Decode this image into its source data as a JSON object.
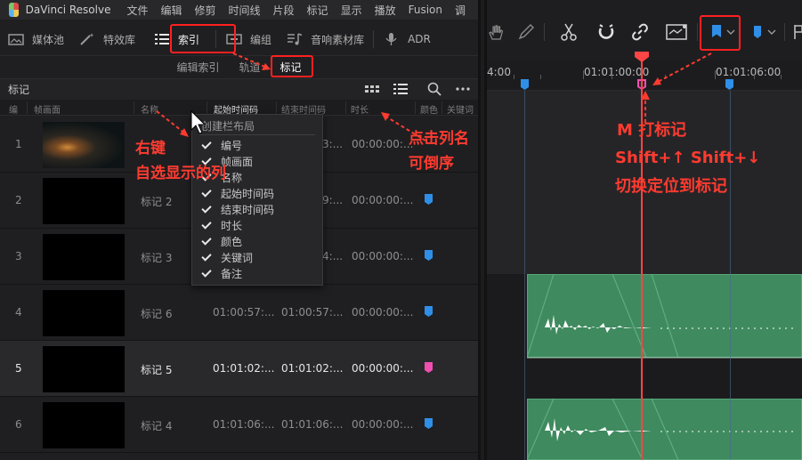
{
  "menubar": {
    "app": "DaVinci Resolve",
    "items": [
      "文件",
      "编辑",
      "修剪",
      "时间线",
      "片段",
      "标记",
      "显示",
      "播放",
      "Fusion",
      "调"
    ]
  },
  "toolbar": {
    "media_pool": "媒体池",
    "effects": "特效库",
    "index": "索引",
    "edit_group": "编组",
    "sound_library": "音响素材库",
    "adr": "ADR"
  },
  "subtabs": {
    "edit_index": "编辑索引",
    "tracks": "轨道",
    "markers": "标记"
  },
  "pane": {
    "title": "标记"
  },
  "columns": {
    "num": "编",
    "thumb": "帧画面",
    "name": "名称",
    "start": "起始时间码",
    "end": "结束时间码",
    "duration": "时长",
    "color": "颜色",
    "keyword": "关键词"
  },
  "rows": [
    {
      "num": "1",
      "name": "",
      "start": "",
      "end": "3:...",
      "duration": "00:00:00:...",
      "color": "",
      "thumb_style": "nebula"
    },
    {
      "num": "2",
      "name": "标记 2",
      "start": "",
      "end": "9:...",
      "duration": "00:00:00:...",
      "color": "#2f8fe8"
    },
    {
      "num": "3",
      "name": "标记 3",
      "start": "",
      "end": "4:...",
      "duration": "00:00:00:...",
      "color": "#2f8fe8"
    },
    {
      "num": "4",
      "name": "标记 6",
      "start": "01:00:57:...",
      "end": "01:00:57:...",
      "duration": "00:00:00:...",
      "color": "#2f8fe8"
    },
    {
      "num": "5",
      "name": "标记 5",
      "start": "01:01:02:...",
      "end": "01:01:02:...",
      "duration": "00:00:00:...",
      "color": "#f04fb0",
      "selected": true
    },
    {
      "num": "6",
      "name": "标记 4",
      "start": "01:01:06:...",
      "end": "01:01:06:...",
      "duration": "00:00:00:...",
      "color": "#2f8fe8"
    }
  ],
  "context_menu": {
    "title": "创建栏布局",
    "items": [
      "编号",
      "帧画面",
      "名称",
      "起始时间码",
      "结束时间码",
      "时长",
      "颜色",
      "关键词",
      "备注"
    ]
  },
  "annotations": {
    "right_click": "右键",
    "choose_columns": "自选显示的列",
    "click_column": "点击列名",
    "reverse_sort": "可倒序",
    "m_marker": "M 打标记",
    "shift_keys": "Shift+↑ Shift+↓",
    "jump_marker": "切换定位到标记"
  },
  "timeline": {
    "tc1": "4:00",
    "tc2": "01:01:00:00",
    "tc3": "01:01:06:00"
  },
  "colors": {
    "accent_red": "#ff3b30",
    "marker_blue": "#2f8fe8",
    "marker_pink": "#f04fb0",
    "clip_green": "#3f8a5f"
  }
}
